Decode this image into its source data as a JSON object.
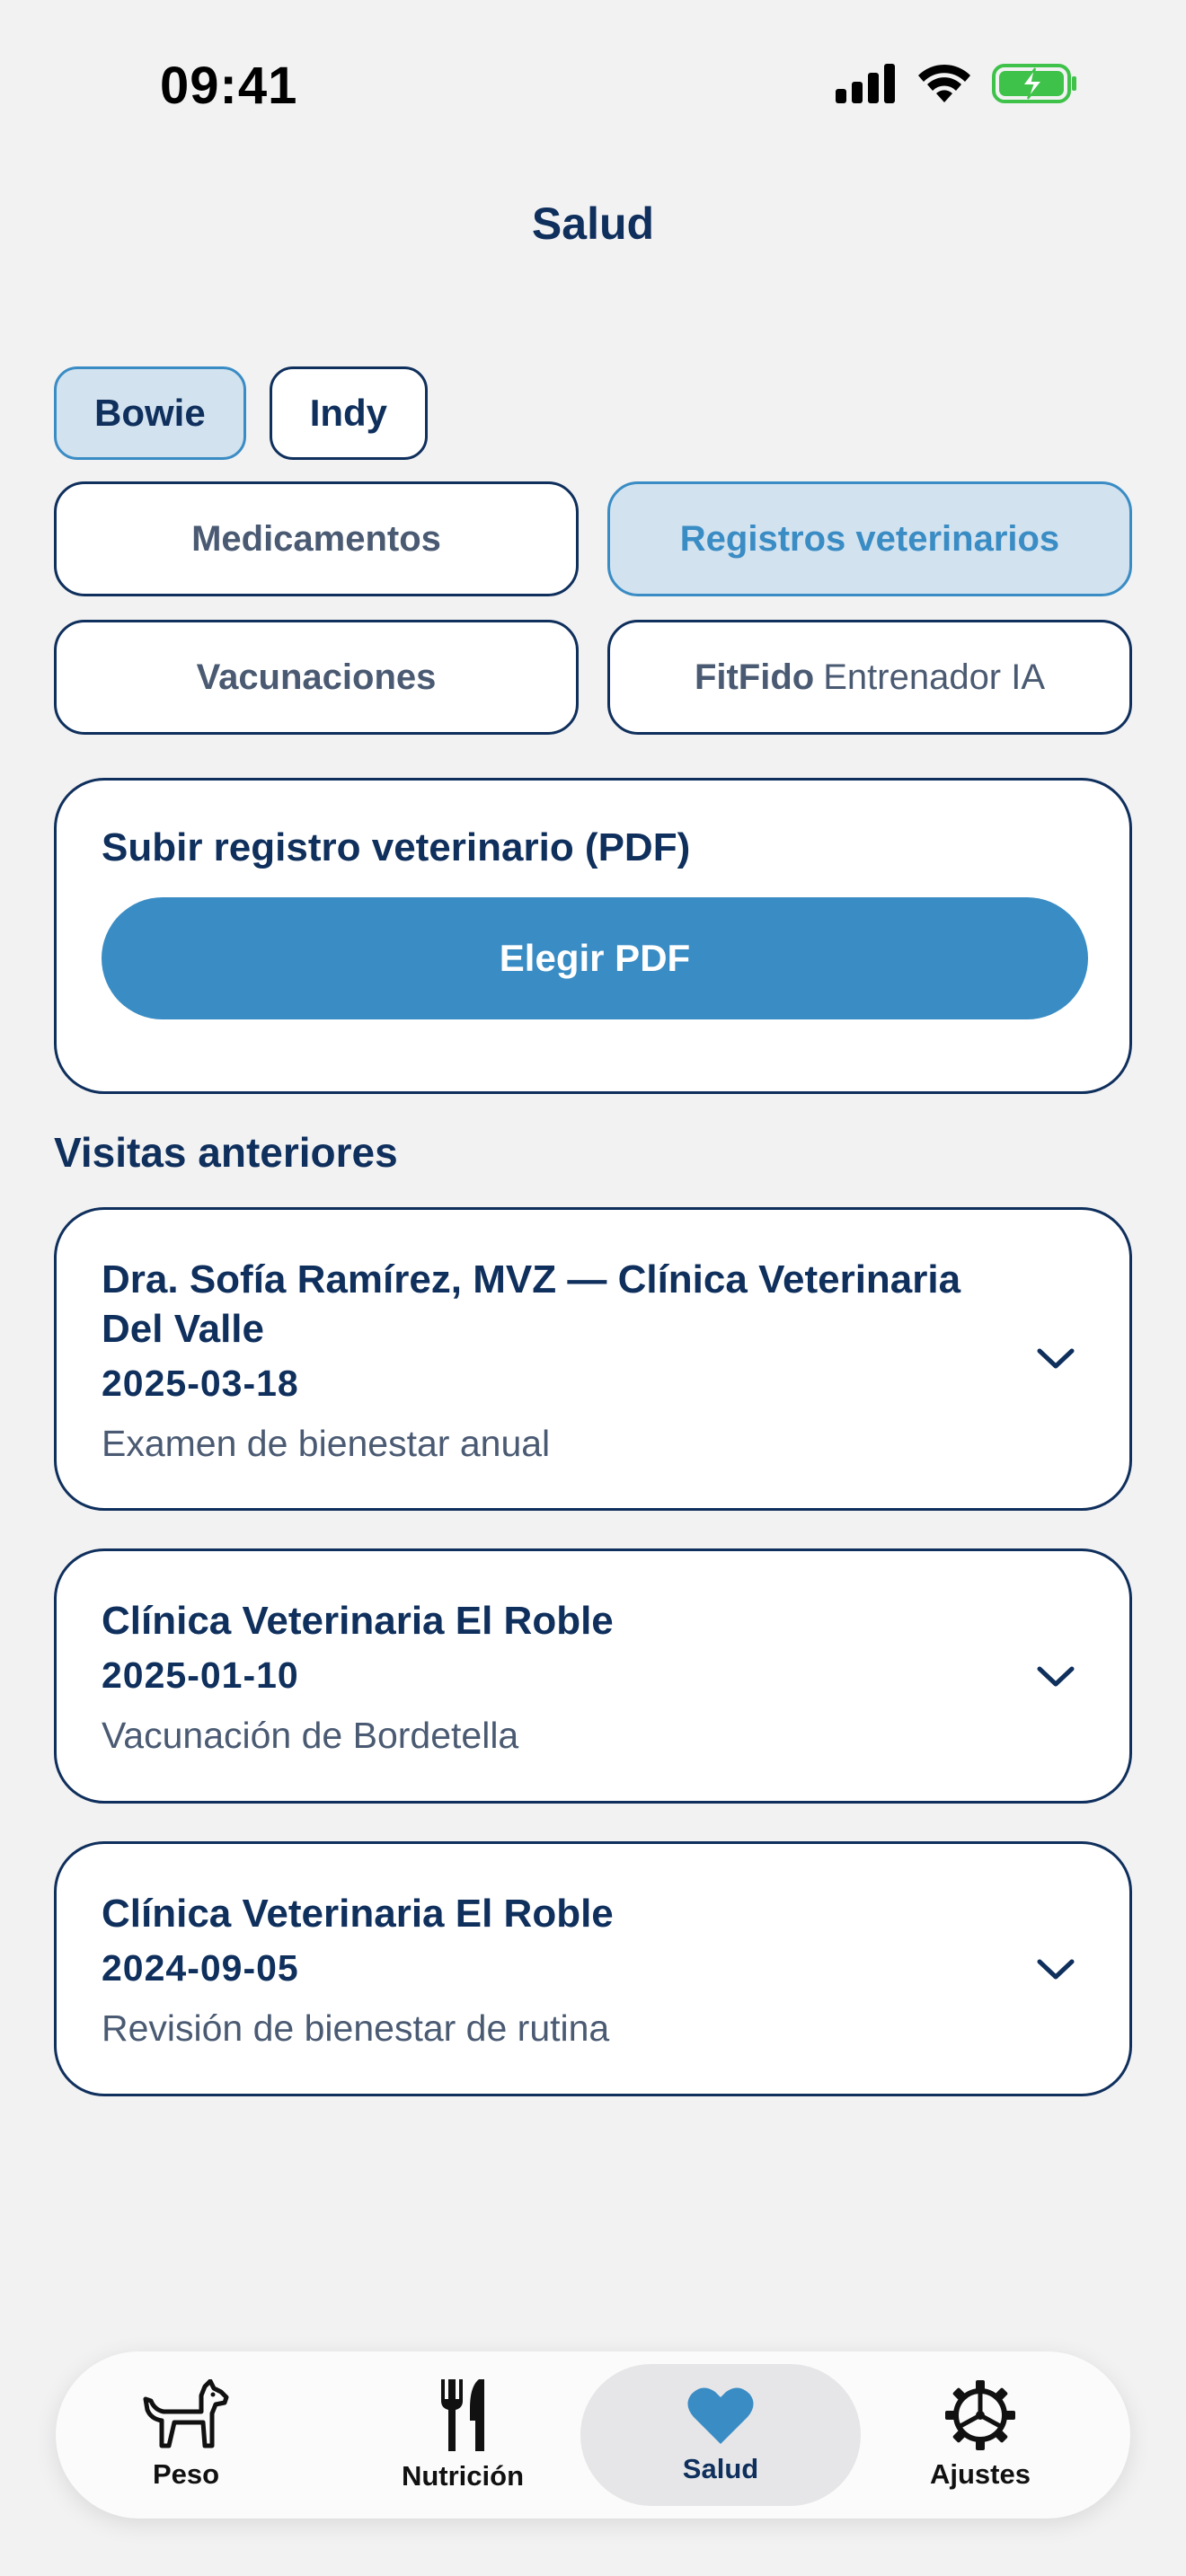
{
  "status_bar": {
    "time": "09:41"
  },
  "header": {
    "title": "Salud"
  },
  "pets": [
    {
      "name": "Bowie",
      "selected": true
    },
    {
      "name": "Indy",
      "selected": false
    }
  ],
  "segments": {
    "medications": "Medicamentos",
    "vet_records": "Registros veterinarios",
    "vaccinations": "Vacunaciones",
    "coach_brand": "FitFido",
    "coach_label": "Entrenador IA"
  },
  "upload": {
    "title": "Subir registro veterinario (PDF)",
    "button_label": "Elegir PDF"
  },
  "visits": {
    "section_title": "Visitas anteriores",
    "items": [
      {
        "name": "Dra. Sofía Ramírez, MVZ — Clínica Veterinaria Del Valle",
        "date": "2025-03-18",
        "description": "Examen de bienestar anual"
      },
      {
        "name": "Clínica Veterinaria El Roble",
        "date": "2025-01-10",
        "description": "Vacunación de Bordetella"
      },
      {
        "name": "Clínica Veterinaria El Roble",
        "date": "2024-09-05",
        "description": "Revisión de bienestar de rutina"
      }
    ]
  },
  "tab_bar": {
    "items": [
      {
        "label": "Peso",
        "icon": "dog-icon"
      },
      {
        "label": "Nutrición",
        "icon": "fork-knife-icon"
      },
      {
        "label": "Salud",
        "icon": "heart-icon",
        "active": true
      },
      {
        "label": "Ajustes",
        "icon": "gear-icon"
      }
    ]
  },
  "colors": {
    "accent": "#3a8cc4",
    "navy": "#0f2f5c",
    "selected_bg": "#d2e2ef",
    "battery_green": "#3fc24a"
  }
}
